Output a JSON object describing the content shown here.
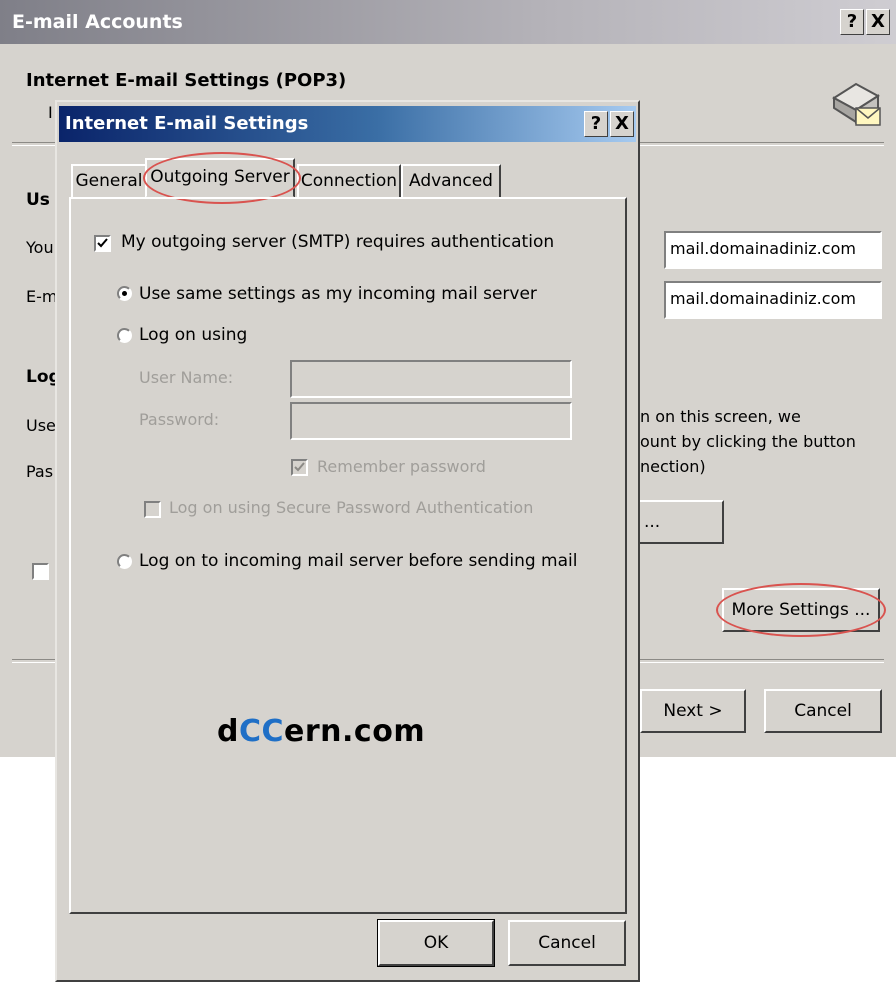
{
  "back_window": {
    "title": "E-mail Accounts",
    "help_glyph": "?",
    "close_glyph": "X",
    "heading": "Internet E-mail Settings (POP3)",
    "subheading_fragment": "I",
    "section_user_fragment": "Us",
    "your_name_fragment": "You",
    "email_fragment": "E-m",
    "logon_fragment": "Log",
    "user_fragment": "Use",
    "pass_fragment": "Pas",
    "incoming_server_value": "mail.domainadiniz.com",
    "outgoing_server_value": "mail.domainadiniz.com",
    "info_line1": "n on this screen, we",
    "info_line2": "ount by clicking the button",
    "info_line3": "nection)",
    "test_button_fragment": "...",
    "more_settings_label": "More Settings ...",
    "next_label": "Next >",
    "cancel_label": "Cancel",
    "icon": "email-account-icon"
  },
  "dialog": {
    "title": "Internet E-mail Settings",
    "help_glyph": "?",
    "close_glyph": "X",
    "tabs": [
      {
        "label": "General",
        "active": false
      },
      {
        "label": "Outgoing Server",
        "active": true
      },
      {
        "label": "Connection",
        "active": false
      },
      {
        "label": "Advanced",
        "active": false
      }
    ],
    "smtp_auth_label": "My outgoing server (SMTP) requires authentication",
    "smtp_auth_checked": true,
    "same_settings_label": "Use same settings as my incoming mail server",
    "same_settings_selected": true,
    "logon_using_label": "Log on using",
    "username_label": "User Name:",
    "password_label": "Password:",
    "remember_password_label": "Remember password",
    "remember_password_checked": true,
    "spa_label": "Log on using Secure Password Authentication",
    "logon_incoming_label": "Log on to incoming mail server before sending mail",
    "ok_label": "OK",
    "cancel_label": "Cancel"
  },
  "watermark": {
    "prefix": "d",
    "highlight": "CC",
    "suffix": "ern.com"
  },
  "colors": {
    "dialog_face": "#d6d3ce",
    "title_active_start": "#0a246a",
    "title_active_end": "#a6caf0",
    "annotation_ring": "#d9534f",
    "watermark_blue": "#1f6fc6"
  }
}
